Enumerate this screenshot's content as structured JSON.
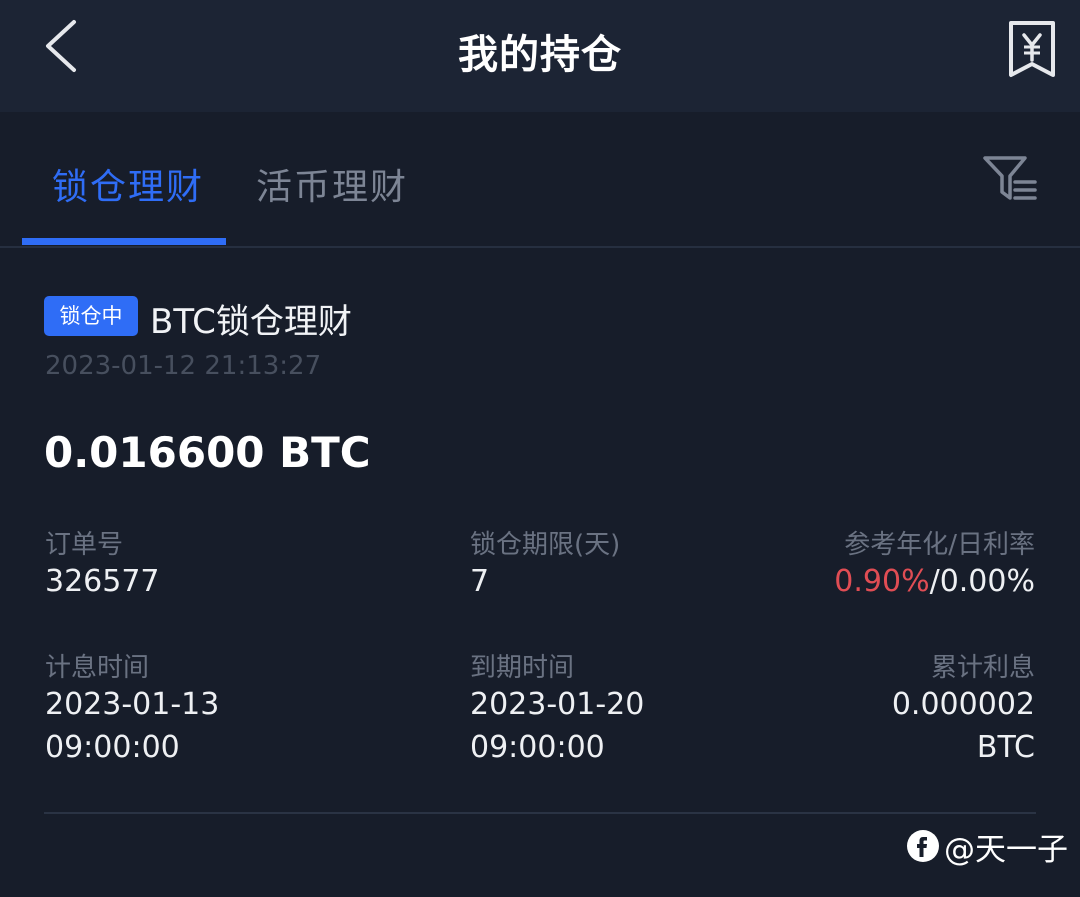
{
  "header": {
    "title": "我的持仓",
    "back_icon": "back-chevron-icon",
    "bill_icon": "yuan-receipt-icon"
  },
  "tabs": [
    {
      "label": "锁仓理财",
      "active": true
    },
    {
      "label": "活币理财",
      "active": false
    }
  ],
  "filter_icon": "filter-list-icon",
  "colors": {
    "accent": "#2f6df6",
    "background": "#171d2a",
    "header_bg": "#1c2434",
    "negative": "#e04d54",
    "muted_text": "#6a7282"
  },
  "position": {
    "status_badge": "锁仓中",
    "product_name": "BTC锁仓理财",
    "created_time": "2023-01-12 21:13:27",
    "amount": "0.016600 BTC",
    "order_no_label": "订单号",
    "order_no": "326577",
    "lock_period_label": "锁仓期限(天)",
    "lock_period": "7",
    "rate_label": "参考年化/日利率",
    "annual_rate": "0.90%",
    "rate_separator": "/",
    "daily_rate": "0.00%",
    "interest_start_label": "计息时间",
    "interest_start_date": "2023-01-13",
    "interest_start_time": "09:00:00",
    "maturity_label": "到期时间",
    "maturity_date": "2023-01-20",
    "maturity_time": "09:00:00",
    "accrued_label": "累计利息",
    "accrued_amount": "0.000002",
    "accrued_unit": "BTC"
  },
  "watermark": {
    "text": "@天一子",
    "icon": "platform-logo-icon"
  }
}
